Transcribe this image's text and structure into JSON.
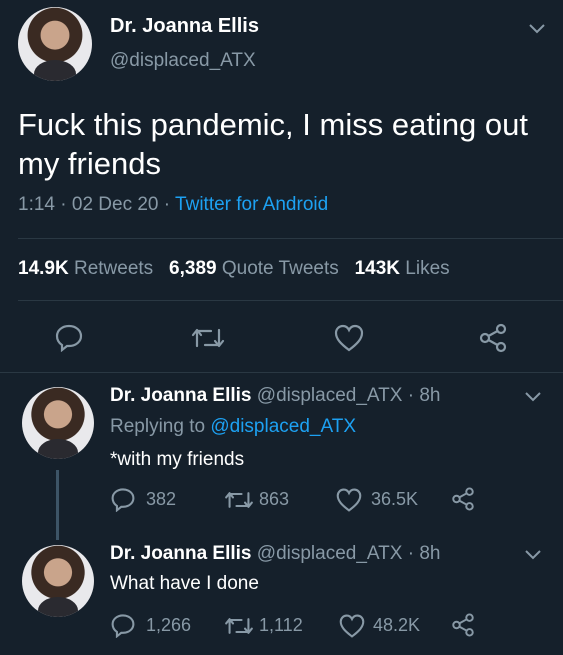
{
  "main_tweet": {
    "author_name": "Dr. Joanna Ellis",
    "handle": "@displaced_ATX",
    "text_line1": "Fuck this pandemic, I miss eating out",
    "text_line2": "my friends",
    "time": "1:14",
    "sep1": "·",
    "date": "02 Dec 20",
    "sep2": "·",
    "client": "Twitter for Android",
    "retweets_count": "14.9K",
    "retweets_label": "Retweets",
    "quote_count": "6,389",
    "quote_label": "Quote Tweets",
    "likes_count": "143K",
    "likes_label": "Likes"
  },
  "reply1": {
    "author_name": "Dr. Joanna Ellis",
    "meta": "@displaced_ATX · 8h",
    "replying_prefix": "Replying to",
    "replying_handle": "@displaced_ATX",
    "text": "*with my friends",
    "replies": "382",
    "retweets": "863",
    "likes": "36.5K"
  },
  "reply2": {
    "author_name": "Dr. Joanna Ellis",
    "meta": "@displaced_ATX · 8h",
    "text": "What have I done",
    "replies": "1,266",
    "retweets": "1,112",
    "likes": "48.2K"
  },
  "colors": {
    "background": "#15202b",
    "muted": "#8899a6",
    "link": "#1da1f2",
    "text": "#ffffff"
  },
  "icons": [
    "reply-icon",
    "retweet-icon",
    "like-icon",
    "share-icon",
    "chevron-down-icon"
  ]
}
